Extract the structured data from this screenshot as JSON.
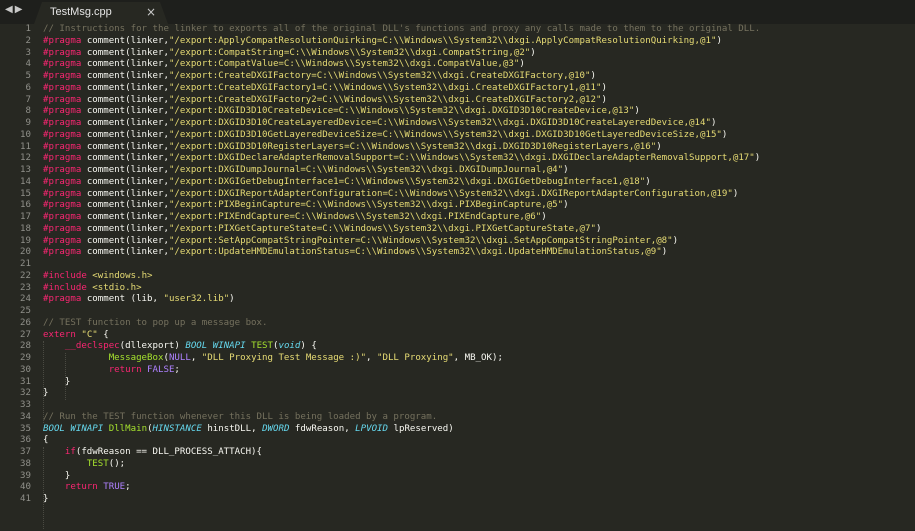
{
  "tab": {
    "title": "TestMsg.cpp",
    "close": "×"
  },
  "nav": {
    "back": "◀",
    "forward": "▶"
  },
  "code": [
    [
      [
        "cm",
        "// Instructions for the linker to exports all of the original DLL's functions and proxy any calls made to them to the original DLL."
      ]
    ],
    [
      [
        "pp",
        "#pragma"
      ],
      [
        "",
        "comment(linker,"
      ],
      [
        "st",
        "\"/export:ApplyCompatResolutionQuirking=C:\\\\Windows\\\\System32\\\\dxgi.ApplyCompatResolutionQuirking,@1\""
      ],
      [
        "",
        ")"
      ]
    ],
    [
      [
        "pp",
        "#pragma"
      ],
      [
        "",
        "comment(linker,"
      ],
      [
        "st",
        "\"/export:CompatString=C:\\\\Windows\\\\System32\\\\dxgi.CompatString,@2\""
      ],
      [
        "",
        ")"
      ]
    ],
    [
      [
        "pp",
        "#pragma"
      ],
      [
        "",
        "comment(linker,"
      ],
      [
        "st",
        "\"/export:CompatValue=C:\\\\Windows\\\\System32\\\\dxgi.CompatValue,@3\""
      ],
      [
        "",
        ")"
      ]
    ],
    [
      [
        "pp",
        "#pragma"
      ],
      [
        "",
        "comment(linker,"
      ],
      [
        "st",
        "\"/export:CreateDXGIFactory=C:\\\\Windows\\\\System32\\\\dxgi.CreateDXGIFactory,@10\""
      ],
      [
        "",
        ")"
      ]
    ],
    [
      [
        "pp",
        "#pragma"
      ],
      [
        "",
        "comment(linker,"
      ],
      [
        "st",
        "\"/export:CreateDXGIFactory1=C:\\\\Windows\\\\System32\\\\dxgi.CreateDXGIFactory1,@11\""
      ],
      [
        "",
        ")"
      ]
    ],
    [
      [
        "pp",
        "#pragma"
      ],
      [
        "",
        "comment(linker,"
      ],
      [
        "st",
        "\"/export:CreateDXGIFactory2=C:\\\\Windows\\\\System32\\\\dxgi.CreateDXGIFactory2,@12\""
      ],
      [
        "",
        ")"
      ]
    ],
    [
      [
        "pp",
        "#pragma"
      ],
      [
        "",
        "comment(linker,"
      ],
      [
        "st",
        "\"/export:DXGID3D10CreateDevice=C:\\\\Windows\\\\System32\\\\dxgi.DXGID3D10CreateDevice,@13\""
      ],
      [
        "",
        ")"
      ]
    ],
    [
      [
        "pp",
        "#pragma"
      ],
      [
        "",
        "comment(linker,"
      ],
      [
        "st",
        "\"/export:DXGID3D10CreateLayeredDevice=C:\\\\Windows\\\\System32\\\\dxgi.DXGID3D10CreateLayeredDevice,@14\""
      ],
      [
        "",
        ")"
      ]
    ],
    [
      [
        "pp",
        "#pragma"
      ],
      [
        "",
        "comment(linker,"
      ],
      [
        "st",
        "\"/export:DXGID3D10GetLayeredDeviceSize=C:\\\\Windows\\\\System32\\\\dxgi.DXGID3D10GetLayeredDeviceSize,@15\""
      ],
      [
        "",
        ")"
      ]
    ],
    [
      [
        "pp",
        "#pragma"
      ],
      [
        "",
        "comment(linker,"
      ],
      [
        "st",
        "\"/export:DXGID3D10RegisterLayers=C:\\\\Windows\\\\System32\\\\dxgi.DXGID3D10RegisterLayers,@16\""
      ],
      [
        "",
        ")"
      ]
    ],
    [
      [
        "pp",
        "#pragma"
      ],
      [
        "",
        "comment(linker,"
      ],
      [
        "st",
        "\"/export:DXGIDeclareAdapterRemovalSupport=C:\\\\Windows\\\\System32\\\\dxgi.DXGIDeclareAdapterRemovalSupport,@17\""
      ],
      [
        "",
        ")"
      ]
    ],
    [
      [
        "pp",
        "#pragma"
      ],
      [
        "",
        "comment(linker,"
      ],
      [
        "st",
        "\"/export:DXGIDumpJournal=C:\\\\Windows\\\\System32\\\\dxgi.DXGIDumpJournal,@4\""
      ],
      [
        "",
        ")"
      ]
    ],
    [
      [
        "pp",
        "#pragma"
      ],
      [
        "",
        "comment(linker,"
      ],
      [
        "st",
        "\"/export:DXGIGetDebugInterface1=C:\\\\Windows\\\\System32\\\\dxgi.DXGIGetDebugInterface1,@18\""
      ],
      [
        "",
        ")"
      ]
    ],
    [
      [
        "pp",
        "#pragma"
      ],
      [
        "",
        "comment(linker,"
      ],
      [
        "st",
        "\"/export:DXGIReportAdapterConfiguration=C:\\\\Windows\\\\System32\\\\dxgi.DXGIReportAdapterConfiguration,@19\""
      ],
      [
        "",
        ")"
      ]
    ],
    [
      [
        "pp",
        "#pragma"
      ],
      [
        "",
        "comment(linker,"
      ],
      [
        "st",
        "\"/export:PIXBeginCapture=C:\\\\Windows\\\\System32\\\\dxgi.PIXBeginCapture,@5\""
      ],
      [
        "",
        ")"
      ]
    ],
    [
      [
        "pp",
        "#pragma"
      ],
      [
        "",
        "comment(linker,"
      ],
      [
        "st",
        "\"/export:PIXEndCapture=C:\\\\Windows\\\\System32\\\\dxgi.PIXEndCapture,@6\""
      ],
      [
        "",
        ")"
      ]
    ],
    [
      [
        "pp",
        "#pragma"
      ],
      [
        "",
        "comment(linker,"
      ],
      [
        "st",
        "\"/export:PIXGetCaptureState=C:\\\\Windows\\\\System32\\\\dxgi.PIXGetCaptureState,@7\""
      ],
      [
        "",
        ")"
      ]
    ],
    [
      [
        "pp",
        "#pragma"
      ],
      [
        "",
        "comment(linker,"
      ],
      [
        "st",
        "\"/export:SetAppCompatStringPointer=C:\\\\Windows\\\\System32\\\\dxgi.SetAppCompatStringPointer,@8\""
      ],
      [
        "",
        ")"
      ]
    ],
    [
      [
        "pp",
        "#pragma"
      ],
      [
        "",
        "comment(linker,"
      ],
      [
        "st",
        "\"/export:UpdateHMDEmulationStatus=C:\\\\Windows\\\\System32\\\\dxgi.UpdateHMDEmulationStatus,@9\""
      ],
      [
        "",
        ")"
      ]
    ],
    [],
    [
      [
        "pp",
        "#include"
      ],
      [
        "st",
        "<windows.h>"
      ]
    ],
    [
      [
        "pp",
        "#include"
      ],
      [
        "st",
        "<stdio.h>"
      ]
    ],
    [
      [
        "pp",
        "#pragma"
      ],
      [
        "",
        "comment (lib, "
      ],
      [
        "st",
        "\"user32.lib\""
      ],
      [
        "",
        ")"
      ]
    ],
    [],
    [
      [
        "cm",
        "// TEST function to pop up a message box."
      ]
    ],
    [
      [
        "kw",
        "extern"
      ],
      [
        "st",
        "\"C\""
      ],
      [
        "",
        "{"
      ]
    ],
    [
      [
        "",
        "    "
      ],
      [
        "kw",
        "__declspec"
      ],
      [
        "",
        "(dllexport) "
      ],
      [
        "ty",
        "BOOL"
      ],
      [
        "ty",
        "WINAPI"
      ],
      [
        "fn",
        "TEST"
      ],
      [
        "",
        "("
      ],
      [
        "ty",
        "void"
      ],
      [
        "",
        ") {"
      ]
    ],
    [
      [
        "",
        "            "
      ],
      [
        "fn",
        "MessageBox"
      ],
      [
        "",
        "("
      ],
      [
        "co",
        "NULL"
      ],
      [
        "",
        ", "
      ],
      [
        "st",
        "\"DLL Proxying Test Message :)\""
      ],
      [
        "",
        ", "
      ],
      [
        "st",
        "\"DLL Proxying\""
      ],
      [
        "",
        ", MB_OK);"
      ]
    ],
    [
      [
        "",
        "            "
      ],
      [
        "kw",
        "return"
      ],
      [
        "co",
        "FALSE"
      ],
      [
        "",
        ";"
      ]
    ],
    [
      [
        "",
        "    }"
      ]
    ],
    [
      [
        "",
        "}"
      ]
    ],
    [],
    [
      [
        "cm",
        "// Run the TEST function whenever this DLL is being loaded by a program."
      ]
    ],
    [
      [
        "ty",
        "BOOL"
      ],
      [
        "ty",
        "WINAPI"
      ],
      [
        "fn",
        "DllMain"
      ],
      [
        "",
        "("
      ],
      [
        "ty",
        "HINSTANCE"
      ],
      [
        "",
        "hinstDLL, "
      ],
      [
        "ty",
        "DWORD"
      ],
      [
        "",
        "fdwReason, "
      ],
      [
        "ty",
        "LPVOID"
      ],
      [
        "",
        "lpReserved)"
      ]
    ],
    [
      [
        "",
        "{"
      ]
    ],
    [
      [
        "",
        "    "
      ],
      [
        "kw",
        "if"
      ],
      [
        "",
        "(fdwReason == DLL_PROCESS_ATTACH){"
      ]
    ],
    [
      [
        "",
        "        "
      ],
      [
        "fn",
        "TEST"
      ],
      [
        "",
        "();"
      ]
    ],
    [
      [
        "",
        "    }"
      ]
    ],
    [
      [
        "",
        "    "
      ],
      [
        "kw",
        "return"
      ],
      [
        "co",
        "TRUE"
      ],
      [
        "",
        ";"
      ]
    ],
    [
      [
        "",
        "}"
      ]
    ]
  ]
}
